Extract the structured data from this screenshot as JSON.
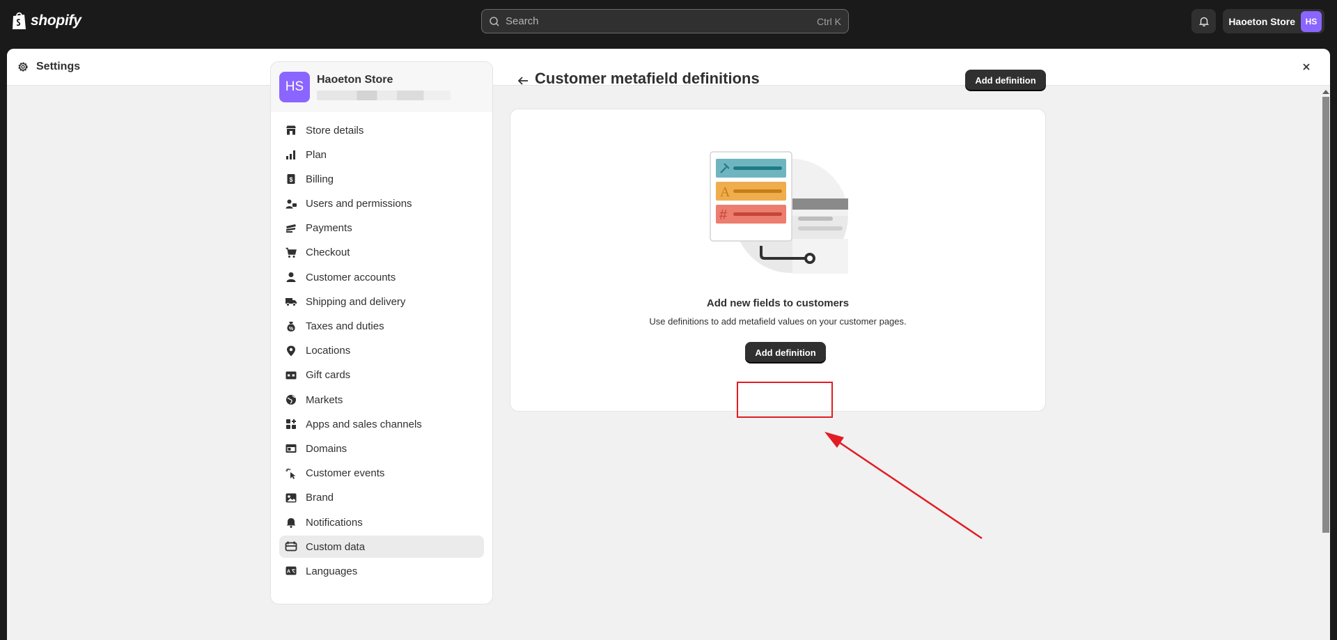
{
  "topbar": {
    "logo_text": "shopify",
    "search_placeholder": "Search",
    "search_shortcut": "Ctrl K",
    "store_name": "Haoeton Store",
    "store_initials": "HS"
  },
  "modal": {
    "title": "Settings"
  },
  "sidebar": {
    "store_name": "Haoeton Store",
    "store_initials": "HS",
    "items": [
      {
        "label": "Store details",
        "icon": "store-icon"
      },
      {
        "label": "Plan",
        "icon": "plan-icon"
      },
      {
        "label": "Billing",
        "icon": "billing-icon"
      },
      {
        "label": "Users and permissions",
        "icon": "users-icon"
      },
      {
        "label": "Payments",
        "icon": "payments-icon"
      },
      {
        "label": "Checkout",
        "icon": "cart-icon"
      },
      {
        "label": "Customer accounts",
        "icon": "person-icon"
      },
      {
        "label": "Shipping and delivery",
        "icon": "truck-icon"
      },
      {
        "label": "Taxes and duties",
        "icon": "money-bag-icon"
      },
      {
        "label": "Locations",
        "icon": "location-pin-icon"
      },
      {
        "label": "Gift cards",
        "icon": "gift-card-icon"
      },
      {
        "label": "Markets",
        "icon": "globe-icon"
      },
      {
        "label": "Apps and sales channels",
        "icon": "apps-icon"
      },
      {
        "label": "Domains",
        "icon": "domain-icon"
      },
      {
        "label": "Customer events",
        "icon": "cursor-icon"
      },
      {
        "label": "Brand",
        "icon": "brand-icon"
      },
      {
        "label": "Notifications",
        "icon": "bell-icon"
      },
      {
        "label": "Custom data",
        "icon": "database-icon",
        "active": true
      },
      {
        "label": "Languages",
        "icon": "language-icon"
      }
    ]
  },
  "main": {
    "page_title": "Customer metafield definitions",
    "add_button": "Add definition",
    "empty_title": "Add new fields to customers",
    "empty_description": "Use definitions to add metafield values on your customer pages.",
    "empty_button": "Add definition"
  },
  "colors": {
    "accent_avatar": "#8b65ff",
    "annotation_red": "#e31b23",
    "button_dark": "#303030"
  }
}
